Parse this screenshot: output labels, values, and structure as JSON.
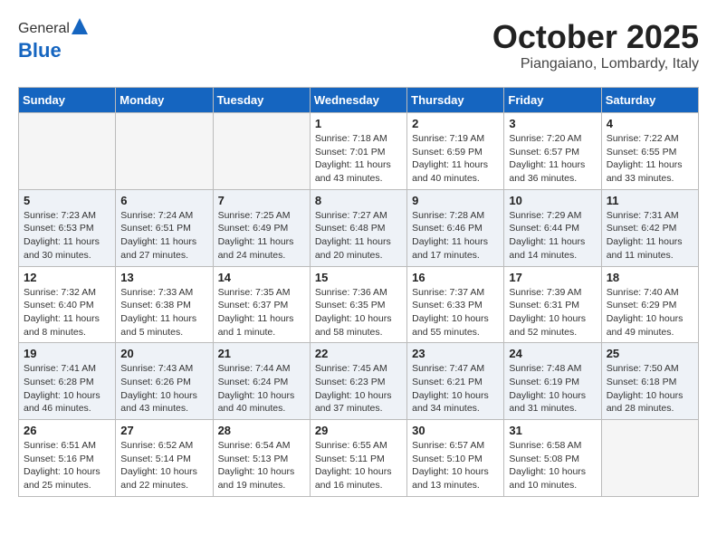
{
  "header": {
    "logo_general": "General",
    "logo_blue": "Blue",
    "month": "October 2025",
    "location": "Piangaiano, Lombardy, Italy"
  },
  "weekdays": [
    "Sunday",
    "Monday",
    "Tuesday",
    "Wednesday",
    "Thursday",
    "Friday",
    "Saturday"
  ],
  "weeks": [
    [
      {
        "day": "",
        "info": ""
      },
      {
        "day": "",
        "info": ""
      },
      {
        "day": "",
        "info": ""
      },
      {
        "day": "1",
        "info": "Sunrise: 7:18 AM\nSunset: 7:01 PM\nDaylight: 11 hours\nand 43 minutes."
      },
      {
        "day": "2",
        "info": "Sunrise: 7:19 AM\nSunset: 6:59 PM\nDaylight: 11 hours\nand 40 minutes."
      },
      {
        "day": "3",
        "info": "Sunrise: 7:20 AM\nSunset: 6:57 PM\nDaylight: 11 hours\nand 36 minutes."
      },
      {
        "day": "4",
        "info": "Sunrise: 7:22 AM\nSunset: 6:55 PM\nDaylight: 11 hours\nand 33 minutes."
      }
    ],
    [
      {
        "day": "5",
        "info": "Sunrise: 7:23 AM\nSunset: 6:53 PM\nDaylight: 11 hours\nand 30 minutes."
      },
      {
        "day": "6",
        "info": "Sunrise: 7:24 AM\nSunset: 6:51 PM\nDaylight: 11 hours\nand 27 minutes."
      },
      {
        "day": "7",
        "info": "Sunrise: 7:25 AM\nSunset: 6:49 PM\nDaylight: 11 hours\nand 24 minutes."
      },
      {
        "day": "8",
        "info": "Sunrise: 7:27 AM\nSunset: 6:48 PM\nDaylight: 11 hours\nand 20 minutes."
      },
      {
        "day": "9",
        "info": "Sunrise: 7:28 AM\nSunset: 6:46 PM\nDaylight: 11 hours\nand 17 minutes."
      },
      {
        "day": "10",
        "info": "Sunrise: 7:29 AM\nSunset: 6:44 PM\nDaylight: 11 hours\nand 14 minutes."
      },
      {
        "day": "11",
        "info": "Sunrise: 7:31 AM\nSunset: 6:42 PM\nDaylight: 11 hours\nand 11 minutes."
      }
    ],
    [
      {
        "day": "12",
        "info": "Sunrise: 7:32 AM\nSunset: 6:40 PM\nDaylight: 11 hours\nand 8 minutes."
      },
      {
        "day": "13",
        "info": "Sunrise: 7:33 AM\nSunset: 6:38 PM\nDaylight: 11 hours\nand 5 minutes."
      },
      {
        "day": "14",
        "info": "Sunrise: 7:35 AM\nSunset: 6:37 PM\nDaylight: 11 hours\nand 1 minute."
      },
      {
        "day": "15",
        "info": "Sunrise: 7:36 AM\nSunset: 6:35 PM\nDaylight: 10 hours\nand 58 minutes."
      },
      {
        "day": "16",
        "info": "Sunrise: 7:37 AM\nSunset: 6:33 PM\nDaylight: 10 hours\nand 55 minutes."
      },
      {
        "day": "17",
        "info": "Sunrise: 7:39 AM\nSunset: 6:31 PM\nDaylight: 10 hours\nand 52 minutes."
      },
      {
        "day": "18",
        "info": "Sunrise: 7:40 AM\nSunset: 6:29 PM\nDaylight: 10 hours\nand 49 minutes."
      }
    ],
    [
      {
        "day": "19",
        "info": "Sunrise: 7:41 AM\nSunset: 6:28 PM\nDaylight: 10 hours\nand 46 minutes."
      },
      {
        "day": "20",
        "info": "Sunrise: 7:43 AM\nSunset: 6:26 PM\nDaylight: 10 hours\nand 43 minutes."
      },
      {
        "day": "21",
        "info": "Sunrise: 7:44 AM\nSunset: 6:24 PM\nDaylight: 10 hours\nand 40 minutes."
      },
      {
        "day": "22",
        "info": "Sunrise: 7:45 AM\nSunset: 6:23 PM\nDaylight: 10 hours\nand 37 minutes."
      },
      {
        "day": "23",
        "info": "Sunrise: 7:47 AM\nSunset: 6:21 PM\nDaylight: 10 hours\nand 34 minutes."
      },
      {
        "day": "24",
        "info": "Sunrise: 7:48 AM\nSunset: 6:19 PM\nDaylight: 10 hours\nand 31 minutes."
      },
      {
        "day": "25",
        "info": "Sunrise: 7:50 AM\nSunset: 6:18 PM\nDaylight: 10 hours\nand 28 minutes."
      }
    ],
    [
      {
        "day": "26",
        "info": "Sunrise: 6:51 AM\nSunset: 5:16 PM\nDaylight: 10 hours\nand 25 minutes."
      },
      {
        "day": "27",
        "info": "Sunrise: 6:52 AM\nSunset: 5:14 PM\nDaylight: 10 hours\nand 22 minutes."
      },
      {
        "day": "28",
        "info": "Sunrise: 6:54 AM\nSunset: 5:13 PM\nDaylight: 10 hours\nand 19 minutes."
      },
      {
        "day": "29",
        "info": "Sunrise: 6:55 AM\nSunset: 5:11 PM\nDaylight: 10 hours\nand 16 minutes."
      },
      {
        "day": "30",
        "info": "Sunrise: 6:57 AM\nSunset: 5:10 PM\nDaylight: 10 hours\nand 13 minutes."
      },
      {
        "day": "31",
        "info": "Sunrise: 6:58 AM\nSunset: 5:08 PM\nDaylight: 10 hours\nand 10 minutes."
      },
      {
        "day": "",
        "info": ""
      }
    ]
  ]
}
